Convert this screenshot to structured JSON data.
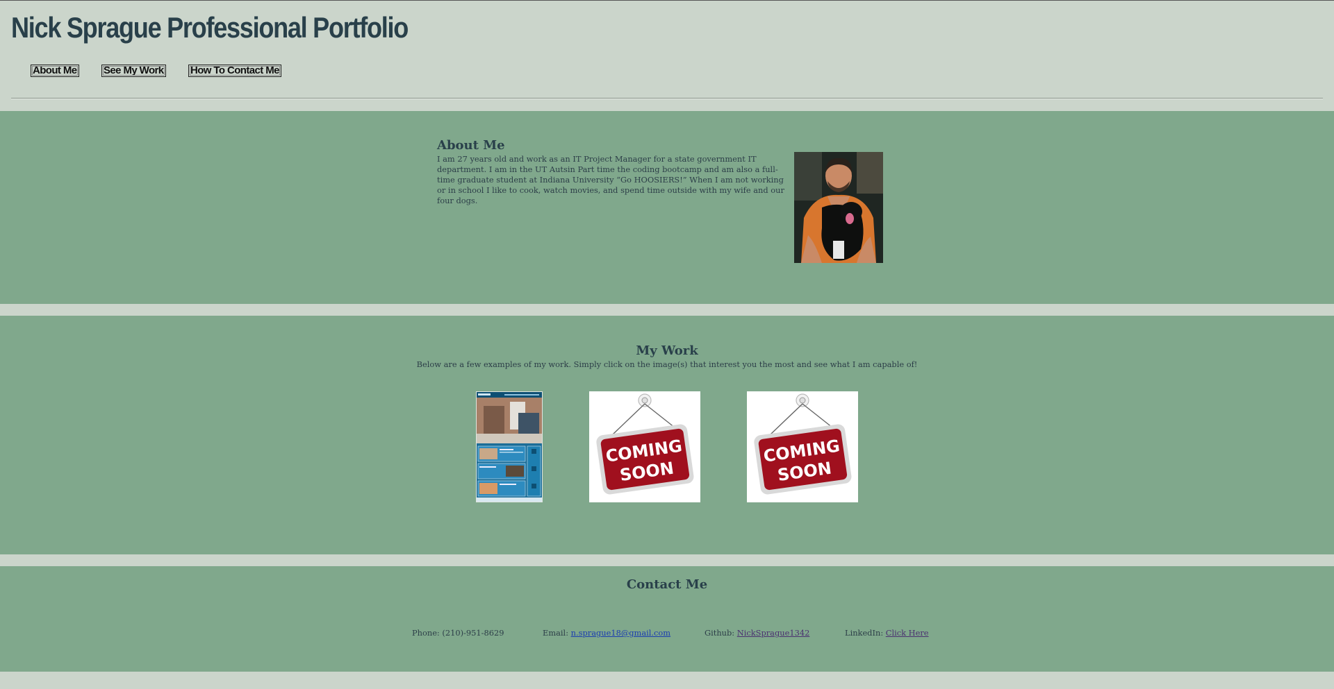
{
  "header": {
    "title": "Nick Sprague Professional Portfolio",
    "nav": [
      "About Me",
      "See My Work",
      "How To Contact Me"
    ]
  },
  "about": {
    "heading": "About Me",
    "paragraph": "I am 27 years old and work as an IT Project Manager for a state government IT department. I am in the UT Autsin Part time the coding bootcamp and am also a full-time graduate student at Indiana University “Go HOOSIERS!” When I am not working or in school I like to cook, watch movies, and spend time outside with my wife and our four dogs."
  },
  "work": {
    "heading": "My Work",
    "subtitle": "Below are a few examples of my work. Simply click on the image(s) that interest you the most and see what I am capable of!",
    "coming_soon": [
      "COMING",
      "SOON"
    ]
  },
  "contact": {
    "heading": "Contact Me",
    "phone_label": "Phone: (210)-951-8629",
    "email_label": "Email:",
    "email": "n.sprague18@gmail.com",
    "github_label": "Github:",
    "github": "NickSprague1342",
    "linkedin_label": "LinkedIn:",
    "linkedin": "Click Here"
  },
  "colors": {
    "page_bg": "#cbd5cb",
    "band_bg": "#80a88c",
    "title_text": "#29404a",
    "link": "#1a3cb0",
    "visited_link": "#4a3070",
    "sign_red": "#a0101e"
  }
}
